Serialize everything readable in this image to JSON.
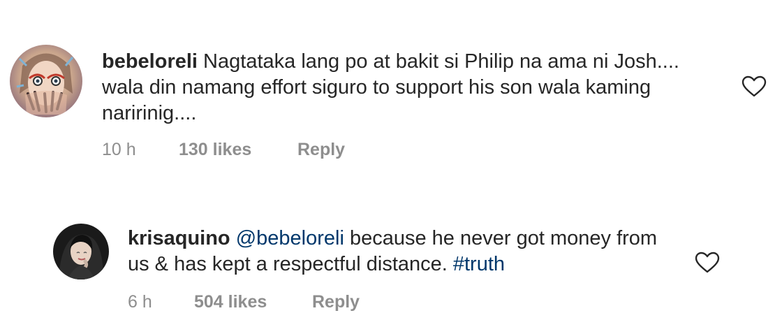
{
  "comments": [
    {
      "username": "bebeloreli",
      "mention": "",
      "text": " Nagtataka lang po at bakit si Philip na ama ni Josh.... wala din namang effort siguro to support his son wala kaming naririnig....",
      "hashtag": "",
      "time": "10 h",
      "likes": "130 likes",
      "reply": "Reply",
      "avatar_icon": "illustrated-avatar-icon",
      "like_icon": "heart-outline-icon"
    },
    {
      "username": "krisaquino",
      "mention": " @bebeloreli",
      "text": " because he never got money from us & has kept a respectful distance. ",
      "hashtag": "#truth",
      "time": "6 h",
      "likes": "504 likes",
      "reply": "Reply",
      "avatar_icon": "photo-avatar-icon",
      "like_icon": "heart-outline-icon"
    }
  ],
  "colors": {
    "text": "#262626",
    "meta": "#8e8e8e",
    "link": "#00376b",
    "background": "#ffffff"
  }
}
